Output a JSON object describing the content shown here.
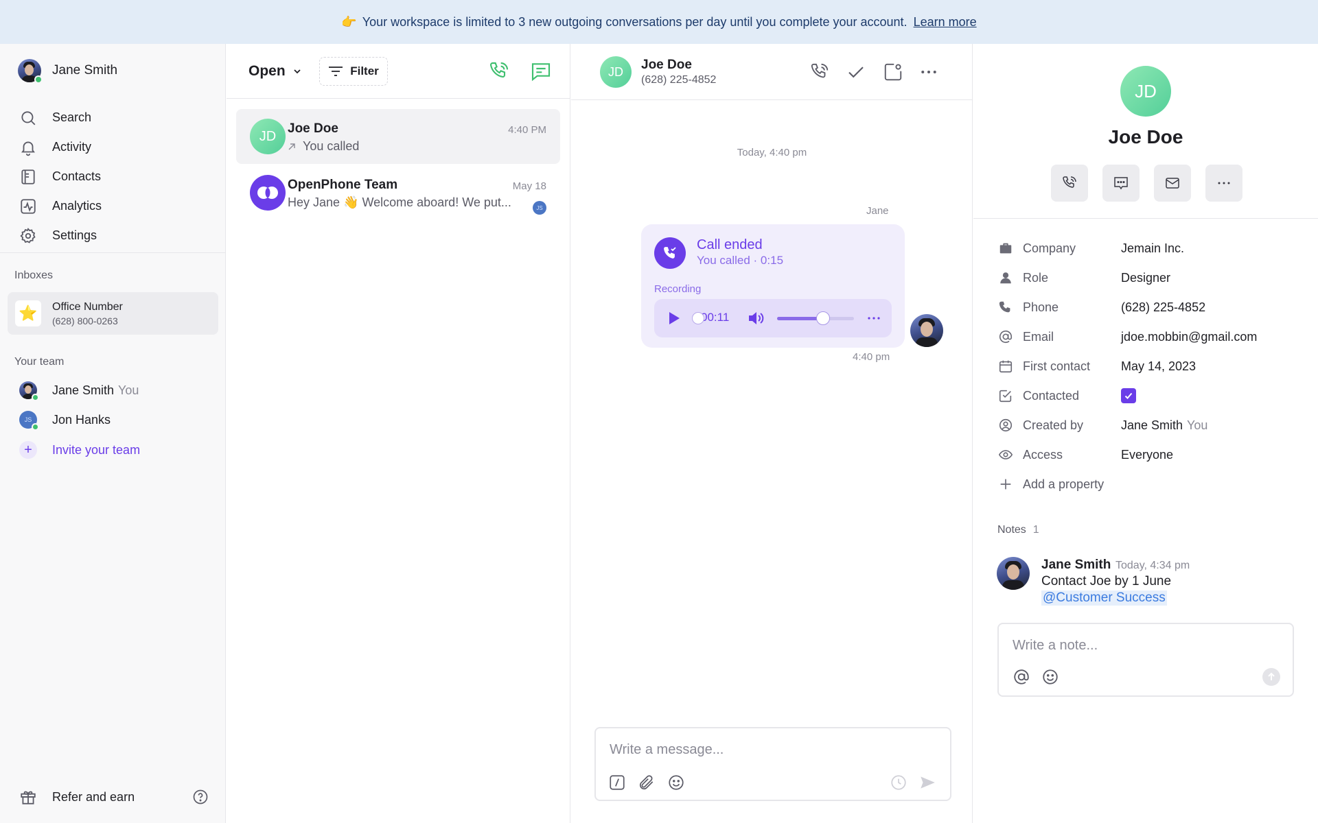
{
  "banner": {
    "emoji": "👉",
    "text": "Your workspace is limited to 3 new outgoing conversations per day until you complete your account.",
    "link": "Learn more"
  },
  "sidebar": {
    "user_name": "Jane Smith",
    "nav": [
      {
        "label": "Search",
        "icon": "search-icon"
      },
      {
        "label": "Activity",
        "icon": "bell-icon"
      },
      {
        "label": "Contacts",
        "icon": "contacts-icon"
      },
      {
        "label": "Analytics",
        "icon": "analytics-icon"
      },
      {
        "label": "Settings",
        "icon": "gear-icon"
      }
    ],
    "inboxes_label": "Inboxes",
    "inbox": {
      "icon": "⭐",
      "name": "Office Number",
      "number": "(628) 800-0263"
    },
    "team_label": "Your team",
    "team": [
      {
        "name": "Jane Smith",
        "tag": "You"
      },
      {
        "name": "Jon Hanks",
        "initials": "JS"
      }
    ],
    "invite_label": "Invite your team",
    "refer_label": "Refer and earn"
  },
  "conv_list": {
    "filter_open": "Open",
    "filter_label": "Filter",
    "items": [
      {
        "initials": "JD",
        "name": "Joe Doe",
        "time": "4:40 PM",
        "preview": "You called"
      },
      {
        "name": "OpenPhone Team",
        "time": "May 18",
        "preview": "Hey Jane 👋 Welcome aboard! We put...",
        "badge": "JS"
      }
    ]
  },
  "chat": {
    "initials": "JD",
    "name": "Joe Doe",
    "phone": "(628) 225-4852",
    "day_separator": "Today, 4:40 pm",
    "sender": "Jane",
    "call": {
      "title": "Call ended",
      "subtitle": "You called · 0:15",
      "recording_label": "Recording",
      "play_time": "00:11",
      "playback_progress": 0.733,
      "volume_level": 0.6
    },
    "msg_time": "4:40 pm",
    "composer_placeholder": "Write a message..."
  },
  "details": {
    "initials": "JD",
    "name": "Joe Doe",
    "properties": [
      {
        "key": "Company",
        "value": "Jemain Inc.",
        "icon": "briefcase-icon"
      },
      {
        "key": "Role",
        "value": "Designer",
        "icon": "person-icon"
      },
      {
        "key": "Phone",
        "value": "(628) 225-4852",
        "icon": "phone-icon"
      },
      {
        "key": "Email",
        "value": "jdoe.mobbin@gmail.com",
        "icon": "at-icon"
      },
      {
        "key": "First contact",
        "value": "May 14, 2023",
        "icon": "calendar-icon"
      },
      {
        "key": "Contacted",
        "value": "",
        "icon": "checklist-icon",
        "checked": true
      },
      {
        "key": "Created by",
        "value": "Jane Smith",
        "tag": "You",
        "icon": "user-circle-icon"
      },
      {
        "key": "Access",
        "value": "Everyone",
        "icon": "eye-icon"
      }
    ],
    "add_property": "Add a property",
    "notes_label": "Notes",
    "notes_count": "1",
    "note": {
      "author": "Jane Smith",
      "time": "Today, 4:34 pm",
      "text": "Contact Joe by 1 June",
      "mention": "@Customer Success"
    },
    "note_placeholder": "Write a note..."
  },
  "colors": {
    "accent": "#6a3de8",
    "green": "#3fbf6f",
    "banner_bg": "#e2ecf7"
  }
}
